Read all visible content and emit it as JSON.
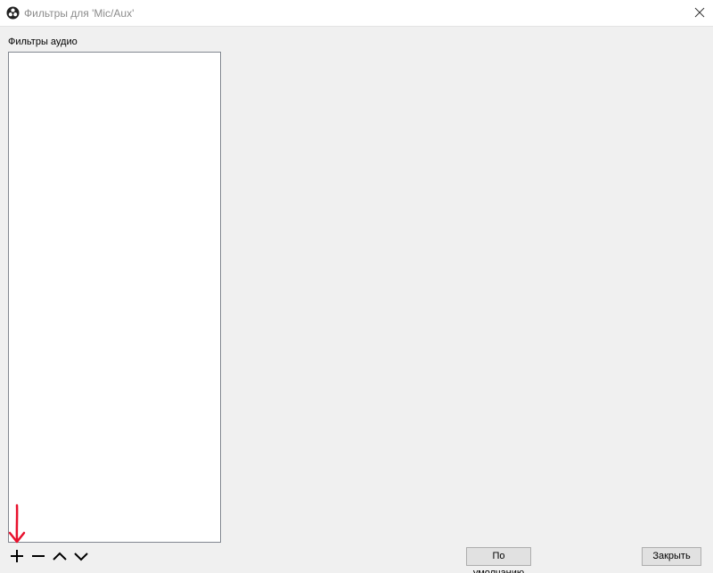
{
  "window": {
    "title": "Фильтры для 'Mic/Aux'",
    "app_icon": "obs-logo-icon",
    "close_icon": "close-icon"
  },
  "filters_panel": {
    "label": "Фильтры аудио",
    "items": []
  },
  "toolbar": {
    "add_icon": "plus-icon",
    "remove_icon": "minus-icon",
    "move_up_icon": "chevron-up-icon",
    "move_down_icon": "chevron-down-icon"
  },
  "buttons": {
    "defaults_label": "По умолчанию",
    "close_label": "Закрыть"
  },
  "colors": {
    "window_bg": "#f0f0f0",
    "titlebar_bg": "#ffffff",
    "annotation_red": "#e8112d"
  }
}
